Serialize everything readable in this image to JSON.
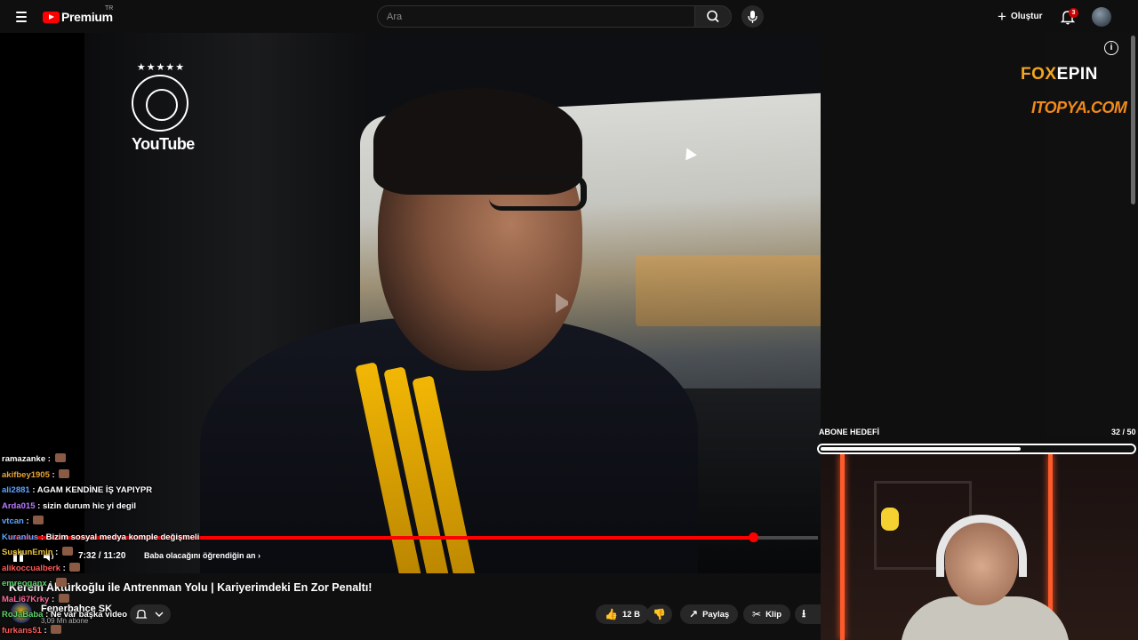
{
  "header": {
    "logo_text": "Premium",
    "region": "TR",
    "search_placeholder": "Ara",
    "create_label": "Oluştur",
    "notification_count": "3"
  },
  "player": {
    "overlay_brand": "YouTube",
    "sponsor_1_part_a": "FOX",
    "sponsor_1_part_b": "EPIN",
    "sponsor_2": "ITOPYA.COM",
    "time": "7:32 / 11:20",
    "chapter": "Baba olacağını öğrendiğin an",
    "chapter_chevron": "›",
    "progress_fraction": 0.92
  },
  "chat": [
    {
      "user": "ramazanke",
      "message": "",
      "color": "#ffffff"
    },
    {
      "user": "akifbey1905",
      "message": "",
      "color": "#e8a33a"
    },
    {
      "user": "ali2881",
      "message": "AGAM KENDİNE İŞ YAPIYPR",
      "color": "#5ea3ff"
    },
    {
      "user": "Arda015",
      "message": "sizin durum hic yi degil",
      "color": "#b87bff"
    },
    {
      "user": "vtcan",
      "message": "",
      "color": "#5ea3ff"
    },
    {
      "user": "Kuranlus",
      "message": "Bizim sosyal medya komple değişmeli",
      "color": "#5ea3ff"
    },
    {
      "user": "SuskunEmin",
      "message": "",
      "color": "#e8c03a"
    },
    {
      "user": "alikoccualberk",
      "message": "",
      "color": "#ff5a5a"
    },
    {
      "user": "emreoganx",
      "message": "",
      "color": "#5fd36a"
    },
    {
      "user": "MaLi67Krky",
      "message": "",
      "color": "#ff6a9a"
    },
    {
      "user": "RoJaBaba",
      "message": "Ne var başka video",
      "color": "#5fd36a"
    },
    {
      "user": "furkans51",
      "message": "",
      "color": "#ff5a5a"
    }
  ],
  "video": {
    "title": "Kerem Aktürkoğlu ile Antrenman Yolu | Kariyerimdeki En Zor Penaltı!",
    "channel_name": "Fenerbahçe SK",
    "subscribers": "3,09 Mn abone",
    "like_count": "12 B",
    "share_label": "Paylaş",
    "clip_label": "Klip"
  },
  "goal": {
    "label": "ABONE HEDEFİ",
    "count": "32 / 50",
    "fraction": 0.64
  },
  "colors": {
    "accent": "#ff0000",
    "neon": "#ff5a2a"
  }
}
